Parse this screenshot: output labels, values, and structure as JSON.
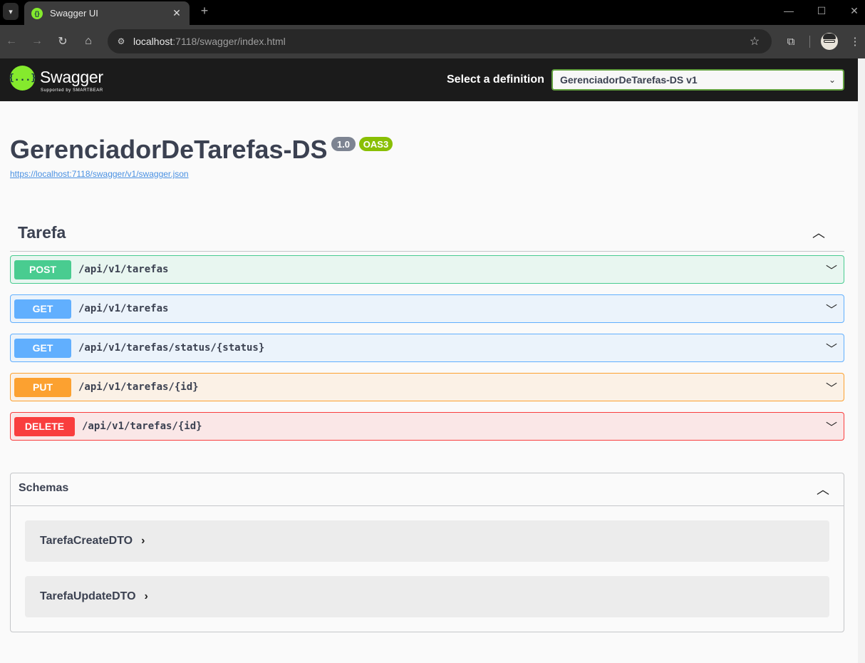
{
  "browser": {
    "tab_title": "Swagger UI",
    "favicon_glyph": "{}",
    "tab_close": "✕",
    "new_tab": "+",
    "window_controls": {
      "minimize": "—",
      "maximize": "☐",
      "close": "✕"
    },
    "url_host": "localhost",
    "url_rest": ":7118/swagger/index.html",
    "icons": [
      "back-icon",
      "forward-icon",
      "reload-icon",
      "home-icon",
      "site-info-icon",
      "bookmark-star-icon",
      "extensions-icon",
      "profile-avatar",
      "menu-kebab-icon"
    ]
  },
  "header": {
    "logo_glyph": "{...}",
    "logo_text": "Swagger",
    "logo_sub": "Supported by SMARTBEAR",
    "definition_label": "Select a definition",
    "definition_selected": "GerenciadorDeTarefas-DS v1",
    "brand_color": "#85ea2d",
    "header_bg": "#1b1b1b"
  },
  "info": {
    "title": "GerenciadorDeTarefas-DS",
    "version": "1.0",
    "oas": "OAS3",
    "spec_url": "https://localhost:7118/swagger/v1/swagger.json"
  },
  "tag": {
    "name": "Tarefa",
    "operations": [
      {
        "method": "POST",
        "path": "/api/v1/tarefas",
        "color": "#49cc90"
      },
      {
        "method": "GET",
        "path": "/api/v1/tarefas",
        "color": "#61affe"
      },
      {
        "method": "GET",
        "path": "/api/v1/tarefas/status/{status}",
        "color": "#61affe"
      },
      {
        "method": "PUT",
        "path": "/api/v1/tarefas/{id}",
        "color": "#fca130"
      },
      {
        "method": "DELETE",
        "path": "/api/v1/tarefas/{id}",
        "color": "#f93e3e"
      }
    ]
  },
  "schemas": {
    "title": "Schemas",
    "models": [
      "TarefaCreateDTO",
      "TarefaUpdateDTO"
    ]
  }
}
